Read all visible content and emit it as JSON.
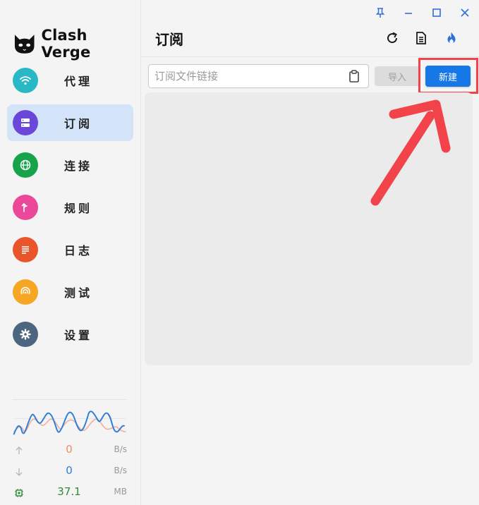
{
  "app": {
    "name": "Clash Verge"
  },
  "nav": {
    "items": [
      {
        "label": "代理",
        "icon": "wifi-icon",
        "color": "#29b9c6"
      },
      {
        "label": "订阅",
        "icon": "server-icon",
        "color": "#6a47d8",
        "active": true
      },
      {
        "label": "连接",
        "icon": "globe-icon",
        "color": "#17a34a"
      },
      {
        "label": "规则",
        "icon": "fork-icon",
        "color": "#ec4899"
      },
      {
        "label": "日志",
        "icon": "list-icon",
        "color": "#e9552b"
      },
      {
        "label": "测试",
        "icon": "signal-icon",
        "color": "#f5a623"
      },
      {
        "label": "设置",
        "icon": "gear-icon",
        "color": "#4d6680"
      }
    ]
  },
  "traffic": {
    "upload_value": "0",
    "upload_unit": "B/s",
    "upload_color": "#f28a6a",
    "download_value": "0",
    "download_unit": "B/s",
    "download_color": "#2f7fd8",
    "memory_value": "37.1",
    "memory_unit": "MB",
    "memory_color": "#2e8b3a"
  },
  "page": {
    "title": "订阅",
    "url_placeholder": "订阅文件链接",
    "url_value": "",
    "import_label": "导入",
    "new_label": "新建"
  },
  "colors": {
    "accent": "#1677e6",
    "active_nav_bg": "#d3e3f8",
    "annotation": "#f2434a"
  }
}
